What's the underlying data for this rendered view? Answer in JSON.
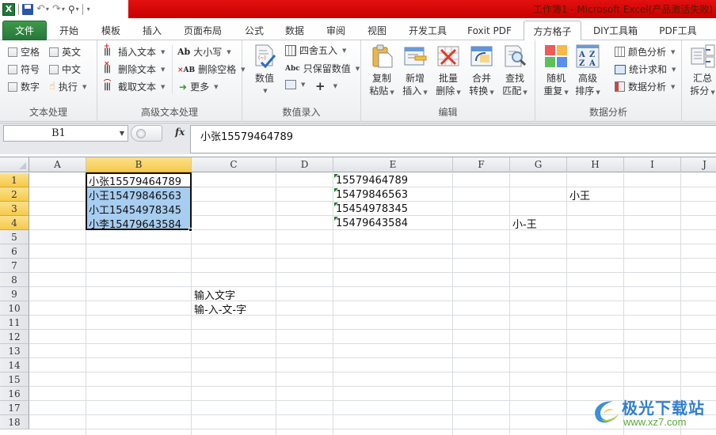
{
  "window": {
    "title": "工作簿1 - Microsoft Excel(产品激活失败)"
  },
  "quick_access": {
    "icons": [
      "excel-logo",
      "save-icon",
      "undo-icon",
      "redo-icon",
      "find-icon",
      "customize-icon"
    ],
    "excel_logo_glyph": "X",
    "undo_glyph": "↶",
    "redo_glyph": "↷",
    "find_glyph": "⚲",
    "customize_glyph": "▾"
  },
  "tabs": [
    {
      "label": "文件",
      "kind": "file"
    },
    {
      "label": "开始"
    },
    {
      "label": "模板"
    },
    {
      "label": "插入"
    },
    {
      "label": "页面布局"
    },
    {
      "label": "公式"
    },
    {
      "label": "数据"
    },
    {
      "label": "审阅"
    },
    {
      "label": "视图"
    },
    {
      "label": "开发工具"
    },
    {
      "label": "Foxit PDF"
    },
    {
      "label": "方方格子",
      "active": true
    },
    {
      "label": "DIY工具箱"
    },
    {
      "label": "PDF工具"
    }
  ],
  "ribbon": {
    "text_processing": {
      "label": "文本处理",
      "checkboxes": [
        {
          "label": "空格",
          "checked": false
        },
        {
          "label": "英文",
          "checked": false
        },
        {
          "label": "符号",
          "checked": false
        },
        {
          "label": "中文",
          "checked": false
        },
        {
          "label": "数字",
          "checked": false
        }
      ],
      "execute": "执行"
    },
    "advanced_text": {
      "label": "高级文本处理",
      "items": [
        {
          "label": "插入文本",
          "icon": "insert-text-icon"
        },
        {
          "label": "删除文本",
          "icon": "delete-text-icon"
        },
        {
          "label": "截取文本",
          "icon": "extract-text-icon"
        },
        {
          "label": "大小写",
          "icon": "case-icon"
        },
        {
          "label": "删除空格",
          "icon": "delete-space-icon"
        },
        {
          "label": "更多",
          "icon": "more-arrow-icon"
        }
      ],
      "ab_glyph": "Ab",
      "xab_glyph": "AB"
    },
    "numeric_entry": {
      "label": "数值录入",
      "big_button": "数值",
      "items": [
        {
          "label": "四舍五入"
        },
        {
          "label": "只保留数值"
        }
      ],
      "abc_glyph": "Abc",
      "plus_glyph": "+"
    },
    "edit": {
      "label": "编辑",
      "buttons": [
        {
          "line1": "复制",
          "line2": "粘贴"
        },
        {
          "line1": "新增",
          "line2": "插入"
        },
        {
          "line1": "批量",
          "line2": "删除"
        },
        {
          "line1": "合并",
          "line2": "转换"
        },
        {
          "line1": "查找",
          "line2": "匹配"
        }
      ]
    },
    "data_analysis": {
      "label": "数据分析",
      "buttons": [
        {
          "line1": "随机",
          "line2": "重复"
        },
        {
          "line1": "高级",
          "line2": "排序"
        }
      ],
      "items": [
        {
          "label": "颜色分析"
        },
        {
          "label": "统计求和"
        },
        {
          "label": "数据分析"
        }
      ]
    },
    "summary": {
      "line1": "汇总",
      "line2": "拆分"
    }
  },
  "formula_bar": {
    "name_box": "B1",
    "fx_label": "fx",
    "formula": "小张15579464789"
  },
  "sheet": {
    "columns": [
      "A",
      "B",
      "C",
      "D",
      "E",
      "F",
      "G",
      "H",
      "I",
      "J"
    ],
    "selected_column": "B",
    "rows": [
      "1",
      "2",
      "3",
      "4",
      "5",
      "6",
      "7",
      "8",
      "9",
      "10",
      "11",
      "12",
      "13",
      "14",
      "15",
      "16",
      "17",
      "18"
    ],
    "selected_rows": [
      "1",
      "2",
      "3",
      "4"
    ],
    "cells": [
      {
        "ref": "B1",
        "value": "小张15579464789",
        "active": true
      },
      {
        "ref": "B2",
        "value": "小王15479846563",
        "highlight": true
      },
      {
        "ref": "B3",
        "value": "小工15454978345",
        "highlight": true
      },
      {
        "ref": "B4",
        "value": "小李15479643584",
        "highlight": true
      },
      {
        "ref": "E1",
        "value": "15579464789",
        "text_number": true
      },
      {
        "ref": "E2",
        "value": "15479846563",
        "text_number": true
      },
      {
        "ref": "E3",
        "value": "15454978345",
        "text_number": true
      },
      {
        "ref": "E4",
        "value": "15479643584",
        "text_number": true
      },
      {
        "ref": "H2",
        "value": "小王"
      },
      {
        "ref": "G4",
        "value": "小-王"
      },
      {
        "ref": "C9",
        "value": "输入文字"
      },
      {
        "ref": "C10",
        "value": "输-入-文-字"
      }
    ]
  },
  "watermark": {
    "name": "极光下载站",
    "url": "www.xz7.com"
  }
}
